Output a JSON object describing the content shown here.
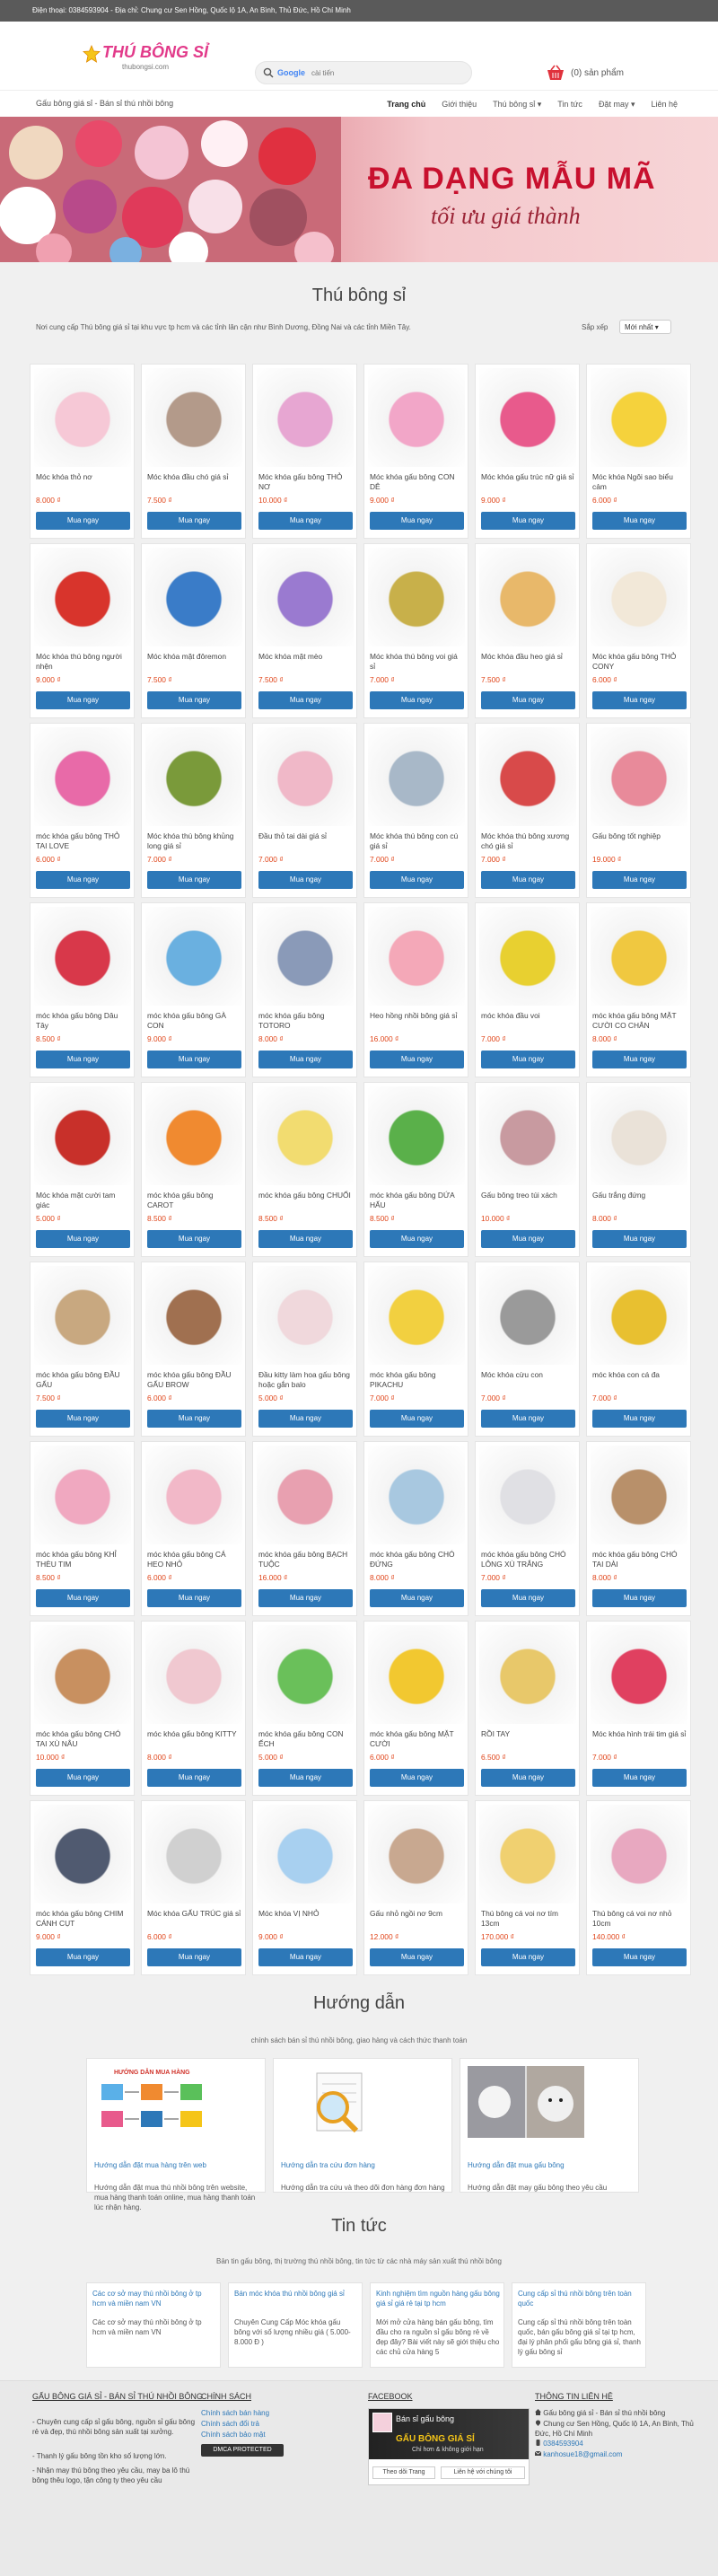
{
  "topbar": "Điện thoại: 0384593904 - Địa chỉ: Chung cư Sen Hồng, Quốc lộ 1A, An Bình, Thủ Đức, Hồ Chí Minh",
  "logo": {
    "brand": "THÚ BÔNG SỈ",
    "domain": "thubongsi.com"
  },
  "search": {
    "google": "Google",
    "placeholder": "cài tiến"
  },
  "cart": {
    "label": "(0) sản phẩm"
  },
  "nav": {
    "left": "Gấu bông giá sỉ - Bán sỉ thú nhồi bông",
    "items": [
      "Trang chủ",
      "Giới thiệu",
      "Thú bông sỉ ▾",
      "Tin tức",
      "Đặt may ▾",
      "Liên hệ"
    ]
  },
  "banner": {
    "line1": "ĐA DẠNG MẪU MÃ",
    "line2": "tối ưu giá thành"
  },
  "main": {
    "title": "Thú bông sỉ",
    "intro": "Nơi cung cấp Thú bông giá sỉ tại khu vực tp hcm và các tỉnh lân cận như Bình Dương, Đồng Nai và các tỉnh Miền Tây.",
    "sort_label": "Sắp xếp",
    "sort_value": "Mới nhất ▾",
    "buy_label": "Mua ngay"
  },
  "products": [
    {
      "name": "Móc khóa thỏ nơ",
      "price": "8.000 ₫",
      "color": "#f6c8d6"
    },
    {
      "name": "Móc khóa đầu chó giá sỉ",
      "price": "7.500 ₫",
      "color": "#b39a8a"
    },
    {
      "name": "Móc khóa gấu bông THỎ NƠ",
      "price": "10.000 ₫",
      "color": "#e7a6d2"
    },
    {
      "name": "Móc khóa gấu bông CON DÊ",
      "price": "9.000 ₫",
      "color": "#f2a6c8"
    },
    {
      "name": "Móc khóa gấu trúc nữ giá sỉ",
      "price": "9.000 ₫",
      "color": "#e85a8c"
    },
    {
      "name": "Móc khóa Ngôi sao biểu cảm",
      "price": "6.000 ₫",
      "color": "#f5d23c"
    },
    {
      "name": "Móc khóa thú bông người nhện",
      "price": "9.000 ₫",
      "color": "#d8342c"
    },
    {
      "name": "Móc khóa mặt đôremon",
      "price": "7.500 ₫",
      "color": "#3a7cc8"
    },
    {
      "name": "Móc khóa mặt mèo",
      "price": "7.500 ₫",
      "color": "#9a7ad0"
    },
    {
      "name": "Móc khóa thú bông voi giá sỉ",
      "price": "7.000 ₫",
      "color": "#c8b04a"
    },
    {
      "name": "Móc khóa đầu heo giá sỉ",
      "price": "7.500 ₫",
      "color": "#e8b86a"
    },
    {
      "name": "Móc khóa gấu bông THỎ CONY",
      "price": "6.000 ₫",
      "color": "#f2e8d8"
    },
    {
      "name": "móc khóa gấu bông THỎ TAI LOVE",
      "price": "6.000 ₫",
      "color": "#e86aa8"
    },
    {
      "name": "Móc khóa thú bông khủng long giá sỉ",
      "price": "7.000 ₫",
      "color": "#7a9a3a"
    },
    {
      "name": "Đầu thỏ tai dài giá sỉ",
      "price": "7.000 ₫",
      "color": "#f0b8c8"
    },
    {
      "name": "Móc khóa thú bông con cú giá sỉ",
      "price": "7.000 ₫",
      "color": "#a8b8c8"
    },
    {
      "name": "Móc khóa thú bông xương chó giá sỉ",
      "price": "7.000 ₫",
      "color": "#d84a4a"
    },
    {
      "name": "Gấu bông tốt nghiệp",
      "price": "19.000 ₫",
      "color": "#e88a9a"
    },
    {
      "name": "móc khóa gấu bông Dâu Tây",
      "price": "8.500 ₫",
      "color": "#d8384a"
    },
    {
      "name": "móc khóa gấu bông GÀ CON",
      "price": "9.000 ₫",
      "color": "#6ab0e0"
    },
    {
      "name": "móc khóa gấu bông TOTORO",
      "price": "8.000 ₫",
      "color": "#8a9ab8"
    },
    {
      "name": "Heo hồng nhồi bông giá sỉ",
      "price": "16.000 ₫",
      "color": "#f4a8b8"
    },
    {
      "name": "móc khóa đầu voi",
      "price": "7.000 ₫",
      "color": "#e8d030"
    },
    {
      "name": "móc khóa gấu bông MẶT CƯỜI CO CHÂN",
      "price": "8.000 ₫",
      "color": "#f0c840"
    },
    {
      "name": "Móc khóa mặt cười tam giác",
      "price": "5.000 ₫",
      "color": "#c8302a"
    },
    {
      "name": "móc khóa gấu bông CAROT",
      "price": "8.500 ₫",
      "color": "#f08a30"
    },
    {
      "name": "móc khóa gấu bông CHUỐI",
      "price": "8.500 ₫",
      "color": "#f2dc70"
    },
    {
      "name": "móc khóa gấu bông DỨA HẤU",
      "price": "8.500 ₫",
      "color": "#5ab04a"
    },
    {
      "name": "Gấu bông treo túi xách",
      "price": "10.000 ₫",
      "color": "#c89aa0"
    },
    {
      "name": "Gấu trắng đứng",
      "price": "8.000 ₫",
      "color": "#eae2d8"
    },
    {
      "name": "móc khóa gấu bông ĐẦU GẤU",
      "price": "7.500 ₫",
      "color": "#c8a880"
    },
    {
      "name": "móc khóa gấu bông ĐẦU GẤU BROW",
      "price": "6.000 ₫",
      "color": "#a07050"
    },
    {
      "name": "Đầu kitty làm hoa gấu bông hoặc gắn balo",
      "price": "5.000 ₫",
      "color": "#f0d8dc"
    },
    {
      "name": "móc khóa gấu bông PIKACHU",
      "price": "7.000 ₫",
      "color": "#f2d040"
    },
    {
      "name": "Móc khóa cừu con",
      "price": "7.000 ₫",
      "color": "#9a9a9a"
    },
    {
      "name": "móc khóa con cá đa",
      "price": "7.000 ₫",
      "color": "#e8c030"
    },
    {
      "name": "móc khóa gấu bông KHỈ THÈU TIM",
      "price": "8.500 ₫",
      "color": "#f0a8c0"
    },
    {
      "name": "móc khóa gấu bông CÁ HEO NHỎ",
      "price": "6.000 ₫",
      "color": "#f2b8c8"
    },
    {
      "name": "móc khóa gấu bông BẠCH TUỘC",
      "price": "16.000 ₫",
      "color": "#e8a0b0"
    },
    {
      "name": "móc khóa gấu bông CHÓ ĐỨNG",
      "price": "8.000 ₫",
      "color": "#a8c8e0"
    },
    {
      "name": "móc khóa gấu bông CHÓ LÔNG XÙ TRẮNG",
      "price": "7.000 ₫",
      "color": "#e0e0e4"
    },
    {
      "name": "móc khóa gấu bông CHÓ TAI DÀI",
      "price": "8.000 ₫",
      "color": "#b8906a"
    },
    {
      "name": "móc khóa gấu bông CHÓ TAI XÙ NÂU",
      "price": "10.000 ₫",
      "color": "#c89060"
    },
    {
      "name": "móc khóa gấu bông KITTY",
      "price": "8.000 ₫",
      "color": "#f0c8d0"
    },
    {
      "name": "móc khóa gấu bông CON ẾCH",
      "price": "5.000 ₫",
      "color": "#6ac05a"
    },
    {
      "name": "móc khóa gấu bông MẶT CƯỜI",
      "price": "6.000 ₫",
      "color": "#f2c830"
    },
    {
      "name": "RỒI TAY",
      "price": "6.500 ₫",
      "color": "#e8c86a"
    },
    {
      "name": "Móc khóa hình trái tim giá sỉ",
      "price": "7.000 ₫",
      "color": "#e04060"
    },
    {
      "name": "móc khóa gấu bông CHIM CÁNH CỤT",
      "price": "9.000 ₫",
      "color": "#505a70"
    },
    {
      "name": "Móc khóa GẤU TRÚC giá sỉ",
      "price": "6.000 ₫",
      "color": "#d0d0d0"
    },
    {
      "name": "Móc khóa VỊ NHỎ",
      "price": "9.000 ₫",
      "color": "#a8d0f0"
    },
    {
      "name": "Gấu nhỏ ngồi nơ 9cm",
      "price": "12.000 ₫",
      "color": "#c8a890"
    },
    {
      "name": "Thú bông cá voi nơ tím 13cm",
      "price": "170.000 ₫",
      "color": "#f0d070"
    },
    {
      "name": "Thú bông cá voi nơ nhỏ 10cm",
      "price": "140.000 ₫",
      "color": "#e8a8c0"
    }
  ],
  "guide": {
    "title": "Hướng dẫn",
    "subtitle": "chính sách bán sỉ thú nhồi bông, giao hàng và cách thức thanh toán",
    "cards": [
      {
        "img_title": "HƯỚNG DẪN MUA HÀNG",
        "link": "Hướng dẫn đặt mua hàng trên web",
        "text": "Hướng dẫn đặt mua thú nhồi bông trên website, mua hàng thanh toán online, mua hàng thanh toán lúc nhận hàng."
      },
      {
        "img_title": "",
        "link": "Hướng dẫn tra cứu đơn hàng",
        "text": "Hướng dẫn tra cứu và theo dõi đơn hàng đơn hàng"
      },
      {
        "img_title": "",
        "link": "Hướng dẫn đặt mua gấu bông",
        "text": "Hướng dẫn đặt may gấu bông theo yêu cầu"
      }
    ]
  },
  "news": {
    "title": "Tin tức",
    "subtitle": "Bản tin gấu bông, thị trường thú nhồi bông, tin tức từ các nhà máy sản xuất thú nhồi bông",
    "cards": [
      {
        "link": "Các cơ sở may thú nhồi bông ở tp hcm và miền nam VN",
        "text": "Các cơ sở may thú nhồi bông ở tp hcm và miền nam VN"
      },
      {
        "link": "Bán móc khóa thú nhồi bông giá sỉ",
        "text": "Chuyên Cung Cấp Móc khóa gấu bông với số lượng nhiều giá ( 5.000-8.000 Đ )"
      },
      {
        "link": "Kinh nghiệm tìm nguồn hàng gấu bông giá sỉ giá rẻ tại tp hcm",
        "text": "Mới mở cửa hàng bán gấu bông, tìm đầu cho ra nguồn sỉ gấu bông rẻ về đẹp đây? Bài viết này sẽ giới thiệu cho các chủ cửa hàng 5"
      },
      {
        "link": "Cung cấp sỉ thú nhồi bông trên toàn quốc",
        "text": "Cung cấp sỉ thú nhồi bông trên toàn quốc, bán gấu bông giá sỉ tại tp hcm, đại lý phân phối gấu bông giá sỉ, thanh lý gấu bông sỉ"
      }
    ]
  },
  "footer": {
    "col1_title": "GẤU BÔNG GIÁ SỈ - BÁN SỈ THÚ NHỒI BÔNG",
    "col1_lines": [
      "- Chuyên cung cấp sỉ gấu bông, nguồn sỉ gấu bông rẻ và đẹp, thú nhồi bông sản xuất tại xưởng.",
      "- Thanh lý gấu bông tồn kho số lượng lớn.",
      "- Nhận may thú bông theo yêu cầu, may ba lô thú bông thêu logo, tặn công ty theo yêu cầu"
    ],
    "col2_title": "CHÍNH SÁCH",
    "col2_links": [
      "Chính sách bán hàng",
      "Chính sách đổi trả",
      "Chính sách bảo mật"
    ],
    "dmca": "DMCA PROTECTED",
    "col3_title": "FACEBOOK",
    "fb_name": "Bán sỉ gấu bông",
    "fb_banner": "GẤU BÔNG GIÁ SỈ",
    "fb_tag": "Chỉ hơn & không giới hạn",
    "fb_follow": "Theo dõi Trang",
    "fb_contact": "Liên hệ với chúng tôi",
    "col4_title": "THÔNG TIN LIÊN HỆ",
    "col4_lines": [
      "Gấu bông giá sỉ - Bán sỉ thú nhồi bông",
      "Chung cư Sen Hồng, Quốc lộ 1A, An Bình, Thủ Đức, Hồ Chí Minh",
      "0384593904",
      "kanhosue18@gmail.com"
    ]
  }
}
